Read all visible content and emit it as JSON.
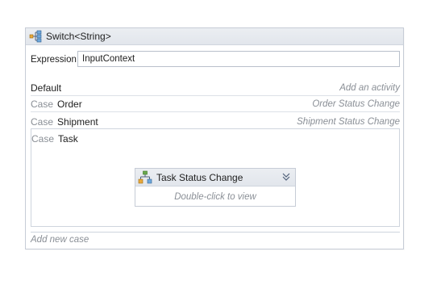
{
  "switch": {
    "title": "Switch<String>",
    "icon": "switch-icon"
  },
  "expression": {
    "label": "Expression",
    "value": "InputContext"
  },
  "default_row": {
    "label": "Default",
    "placeholder": "Add an activity"
  },
  "cases": [
    {
      "case_word": "Case",
      "name": "Order",
      "activity": "Order Status Change"
    },
    {
      "case_word": "Case",
      "name": "Shipment",
      "activity": "Shipment Status Change"
    },
    {
      "case_word": "Case",
      "name": "Task"
    }
  ],
  "task_activity": {
    "title": "Task Status Change",
    "icon": "flowchart-icon",
    "collapse_icon": "double-chevron-down-icon",
    "body": "Double-click to view"
  },
  "add_case": {
    "label": "Add new case"
  },
  "colors": {
    "header_bg": "#e5e9ee",
    "border": "#c6ccd6",
    "muted_text": "#8a8f96",
    "text": "#1e1e1e"
  }
}
